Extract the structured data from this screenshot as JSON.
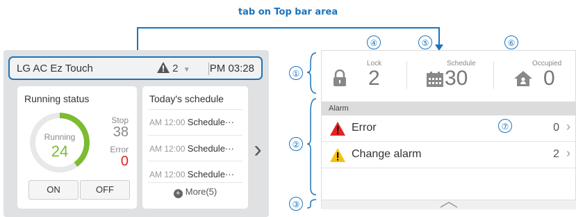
{
  "caption": "tab on Top bar area",
  "callouts": [
    "①",
    "②",
    "③",
    "④",
    "⑤",
    "⑥",
    "⑦"
  ],
  "colors": {
    "accent_blue": "#1a74bd",
    "running_green": "#7cbb32",
    "error_red": "#e32323",
    "warning_yellow": "#f4c20d"
  },
  "top_bar": {
    "title": "LG AC Ez Touch",
    "alarm_icon": "warning-triangle-icon",
    "alarm_count": "2",
    "dropdown_icon": "chevron-down-icon",
    "time": "PM 03:28"
  },
  "running_status": {
    "title": "Running status",
    "running_label": "Running",
    "running_value": "24",
    "running_fraction": 0.4,
    "stop_label": "Stop",
    "stop_value": "38",
    "error_label": "Error",
    "error_value": "0",
    "on_label": "ON",
    "off_label": "OFF"
  },
  "todays_schedule": {
    "title": "Today's schedule",
    "items": [
      {
        "time": "AM 12:00",
        "name": "Schedule···"
      },
      {
        "time": "AM 12:00",
        "name": "Schedule···"
      },
      {
        "time": "AM 12:00",
        "name": "Schedule···"
      }
    ],
    "more_label": "More(5)"
  },
  "next_icon": "chevron-right-icon",
  "status_bar": {
    "lock_label": "Lock",
    "lock_value": "2",
    "lock_icon": "lock-icon",
    "schedule_label": "Schedule",
    "schedule_value": "30",
    "schedule_icon": "calendar-icon",
    "occupied_label": "Occupied",
    "occupied_value": "0",
    "occupied_icon": "house-icon"
  },
  "alarm": {
    "header": "Alarm",
    "rows": [
      {
        "label": "Error",
        "count": "0",
        "icon": "error-triangle-icon"
      },
      {
        "label": "Change alarm",
        "count": "2",
        "icon": "warning-triangle-icon"
      }
    ]
  }
}
